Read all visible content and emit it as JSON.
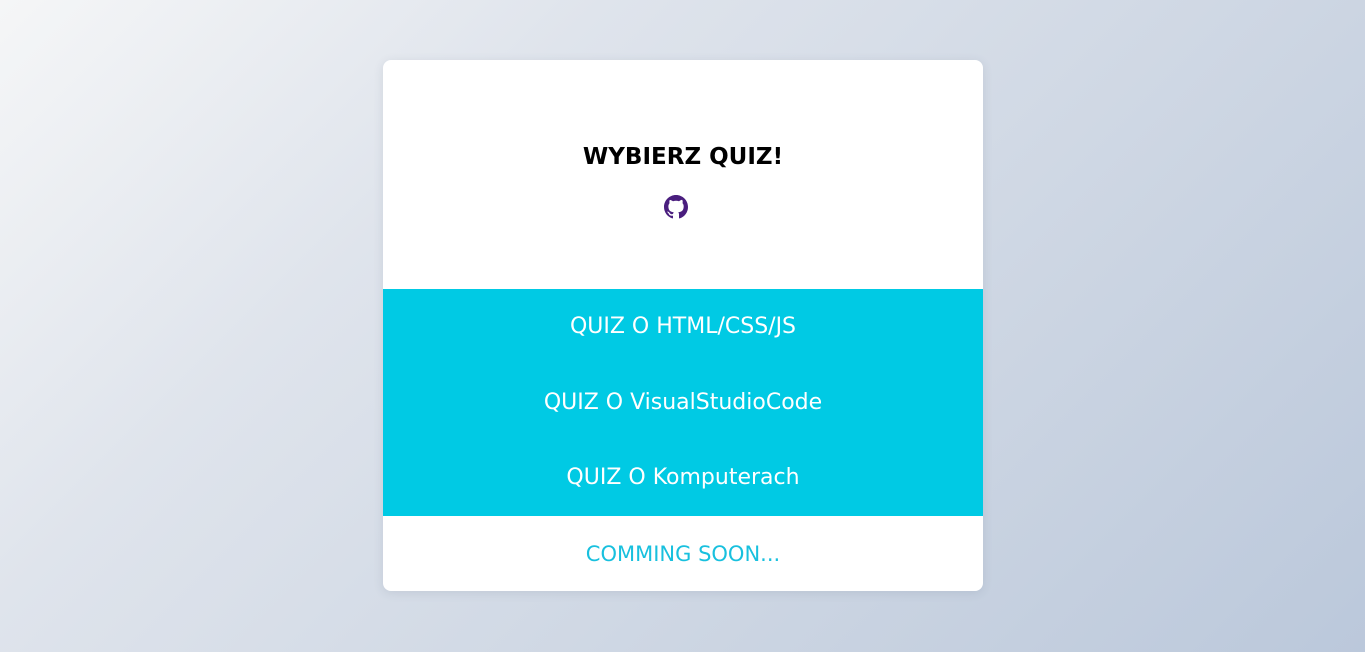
{
  "colors": {
    "accent": "#00cae4",
    "coming_soon": "#18c0de",
    "github_icon": "#4a1e7e",
    "title": "#000000"
  },
  "header": {
    "title": "WYBIERZ QUIZ!",
    "icon": "github-icon"
  },
  "quizzes": [
    {
      "label": "QUIZ O HTML/CSS/JS"
    },
    {
      "label": "QUIZ O VisualStudioCode"
    },
    {
      "label": "QUIZ O Komputerach"
    }
  ],
  "footer": {
    "coming_soon": "COMMING SOON..."
  }
}
